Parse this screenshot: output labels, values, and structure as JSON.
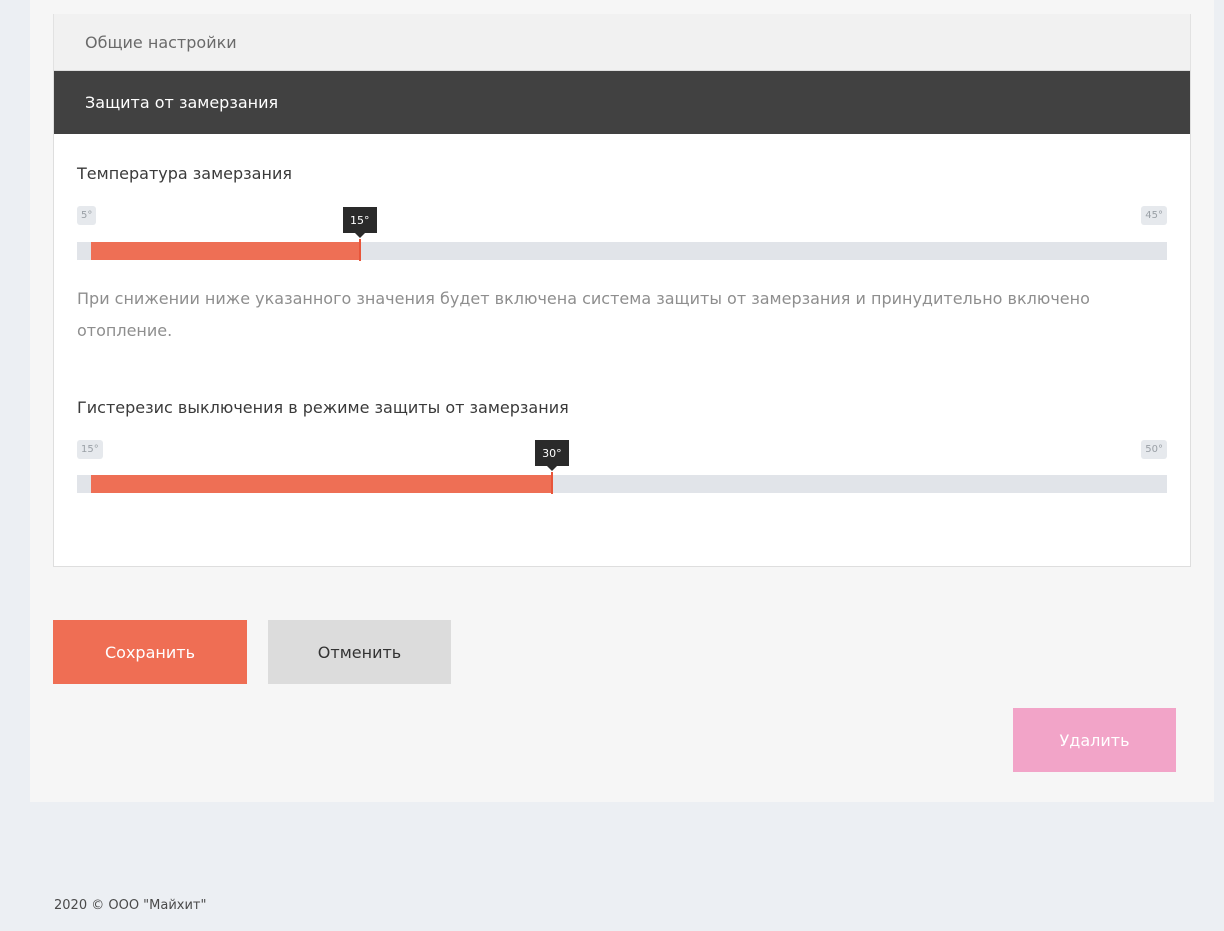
{
  "sections": {
    "general": {
      "label": "Общие настройки"
    },
    "frost": {
      "label": "Защита от замерзания"
    }
  },
  "freeze_temp": {
    "label": "Температура замерзания",
    "min": "5°",
    "max": "45°",
    "value": "15°",
    "fill_fraction": 0.25
  },
  "help_text": "При снижении ниже указанного значения будет включена система защиты от замерзания и принудительно включено отопление.",
  "hysteresis": {
    "label": "Гистерезис выключения в режиме защиты от замерзания",
    "min": "15°",
    "max": "50°",
    "value": "30°",
    "fill_fraction": 0.4286
  },
  "buttons": {
    "save": "Сохранить",
    "cancel": "Отменить",
    "delete": "Удалить"
  },
  "footer": "2020 © ООО \"Майхит\"",
  "colors": {
    "accent": "#ef6e54",
    "header_dark": "#414141",
    "delete_disabled": "#f2a4c8"
  }
}
